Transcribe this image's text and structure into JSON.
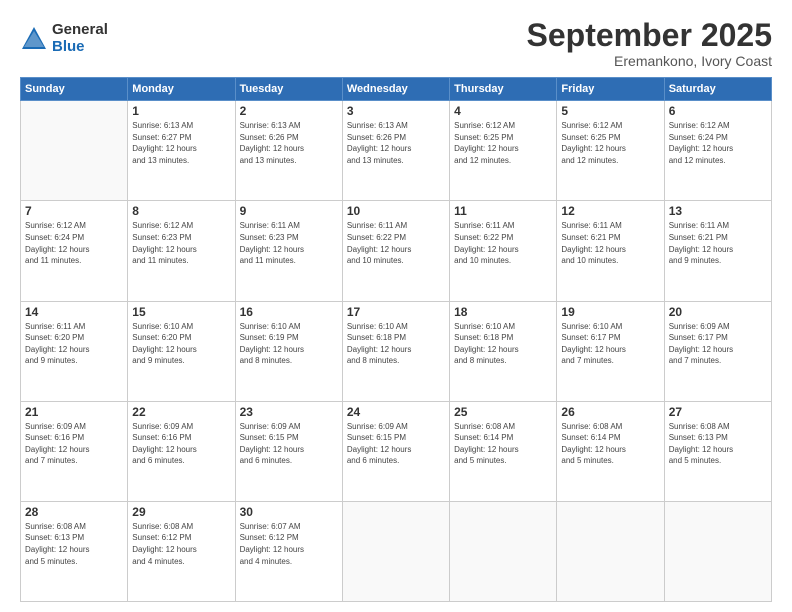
{
  "logo": {
    "general": "General",
    "blue": "Blue"
  },
  "title": "September 2025",
  "subtitle": "Eremankono, Ivory Coast",
  "days_header": [
    "Sunday",
    "Monday",
    "Tuesday",
    "Wednesday",
    "Thursday",
    "Friday",
    "Saturday"
  ],
  "weeks": [
    [
      {
        "day": "",
        "info": ""
      },
      {
        "day": "1",
        "info": "Sunrise: 6:13 AM\nSunset: 6:27 PM\nDaylight: 12 hours\nand 13 minutes."
      },
      {
        "day": "2",
        "info": "Sunrise: 6:13 AM\nSunset: 6:26 PM\nDaylight: 12 hours\nand 13 minutes."
      },
      {
        "day": "3",
        "info": "Sunrise: 6:13 AM\nSunset: 6:26 PM\nDaylight: 12 hours\nand 13 minutes."
      },
      {
        "day": "4",
        "info": "Sunrise: 6:12 AM\nSunset: 6:25 PM\nDaylight: 12 hours\nand 12 minutes."
      },
      {
        "day": "5",
        "info": "Sunrise: 6:12 AM\nSunset: 6:25 PM\nDaylight: 12 hours\nand 12 minutes."
      },
      {
        "day": "6",
        "info": "Sunrise: 6:12 AM\nSunset: 6:24 PM\nDaylight: 12 hours\nand 12 minutes."
      }
    ],
    [
      {
        "day": "7",
        "info": "Sunrise: 6:12 AM\nSunset: 6:24 PM\nDaylight: 12 hours\nand 11 minutes."
      },
      {
        "day": "8",
        "info": "Sunrise: 6:12 AM\nSunset: 6:23 PM\nDaylight: 12 hours\nand 11 minutes."
      },
      {
        "day": "9",
        "info": "Sunrise: 6:11 AM\nSunset: 6:23 PM\nDaylight: 12 hours\nand 11 minutes."
      },
      {
        "day": "10",
        "info": "Sunrise: 6:11 AM\nSunset: 6:22 PM\nDaylight: 12 hours\nand 10 minutes."
      },
      {
        "day": "11",
        "info": "Sunrise: 6:11 AM\nSunset: 6:22 PM\nDaylight: 12 hours\nand 10 minutes."
      },
      {
        "day": "12",
        "info": "Sunrise: 6:11 AM\nSunset: 6:21 PM\nDaylight: 12 hours\nand 10 minutes."
      },
      {
        "day": "13",
        "info": "Sunrise: 6:11 AM\nSunset: 6:21 PM\nDaylight: 12 hours\nand 9 minutes."
      }
    ],
    [
      {
        "day": "14",
        "info": "Sunrise: 6:11 AM\nSunset: 6:20 PM\nDaylight: 12 hours\nand 9 minutes."
      },
      {
        "day": "15",
        "info": "Sunrise: 6:10 AM\nSunset: 6:20 PM\nDaylight: 12 hours\nand 9 minutes."
      },
      {
        "day": "16",
        "info": "Sunrise: 6:10 AM\nSunset: 6:19 PM\nDaylight: 12 hours\nand 8 minutes."
      },
      {
        "day": "17",
        "info": "Sunrise: 6:10 AM\nSunset: 6:18 PM\nDaylight: 12 hours\nand 8 minutes."
      },
      {
        "day": "18",
        "info": "Sunrise: 6:10 AM\nSunset: 6:18 PM\nDaylight: 12 hours\nand 8 minutes."
      },
      {
        "day": "19",
        "info": "Sunrise: 6:10 AM\nSunset: 6:17 PM\nDaylight: 12 hours\nand 7 minutes."
      },
      {
        "day": "20",
        "info": "Sunrise: 6:09 AM\nSunset: 6:17 PM\nDaylight: 12 hours\nand 7 minutes."
      }
    ],
    [
      {
        "day": "21",
        "info": "Sunrise: 6:09 AM\nSunset: 6:16 PM\nDaylight: 12 hours\nand 7 minutes."
      },
      {
        "day": "22",
        "info": "Sunrise: 6:09 AM\nSunset: 6:16 PM\nDaylight: 12 hours\nand 6 minutes."
      },
      {
        "day": "23",
        "info": "Sunrise: 6:09 AM\nSunset: 6:15 PM\nDaylight: 12 hours\nand 6 minutes."
      },
      {
        "day": "24",
        "info": "Sunrise: 6:09 AM\nSunset: 6:15 PM\nDaylight: 12 hours\nand 6 minutes."
      },
      {
        "day": "25",
        "info": "Sunrise: 6:08 AM\nSunset: 6:14 PM\nDaylight: 12 hours\nand 5 minutes."
      },
      {
        "day": "26",
        "info": "Sunrise: 6:08 AM\nSunset: 6:14 PM\nDaylight: 12 hours\nand 5 minutes."
      },
      {
        "day": "27",
        "info": "Sunrise: 6:08 AM\nSunset: 6:13 PM\nDaylight: 12 hours\nand 5 minutes."
      }
    ],
    [
      {
        "day": "28",
        "info": "Sunrise: 6:08 AM\nSunset: 6:13 PM\nDaylight: 12 hours\nand 5 minutes."
      },
      {
        "day": "29",
        "info": "Sunrise: 6:08 AM\nSunset: 6:12 PM\nDaylight: 12 hours\nand 4 minutes."
      },
      {
        "day": "30",
        "info": "Sunrise: 6:07 AM\nSunset: 6:12 PM\nDaylight: 12 hours\nand 4 minutes."
      },
      {
        "day": "",
        "info": ""
      },
      {
        "day": "",
        "info": ""
      },
      {
        "day": "",
        "info": ""
      },
      {
        "day": "",
        "info": ""
      }
    ]
  ]
}
